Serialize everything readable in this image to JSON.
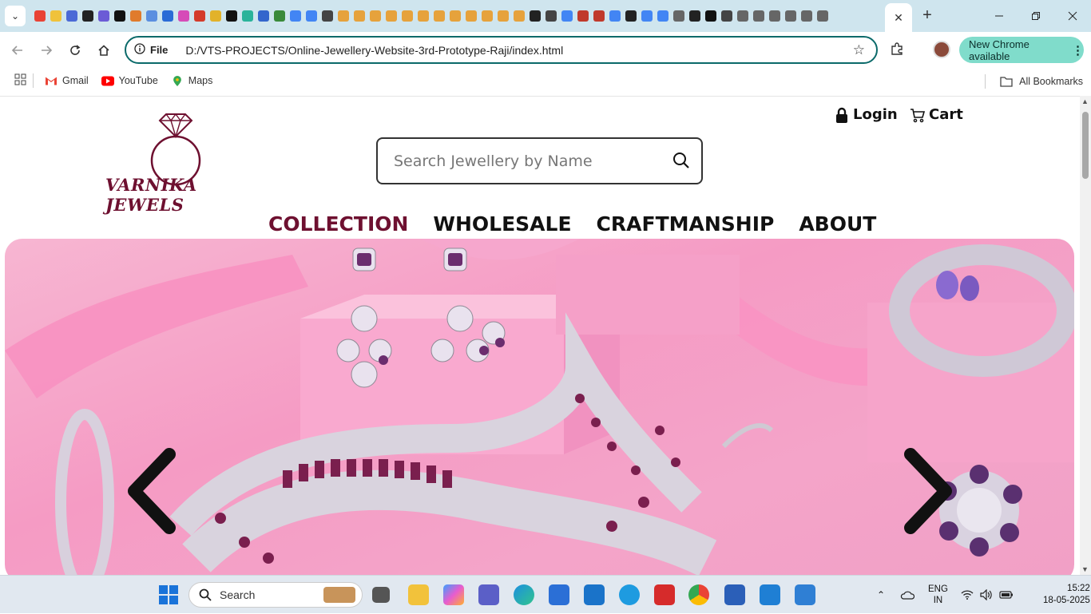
{
  "browser": {
    "active_tab_close": "✕",
    "new_tab": "+",
    "url_prefix": "File",
    "url": "D:/VTS-PROJECTS/Online-Jewellery-Website-3rd-Prototype-Raji/index.html",
    "update_notice": "New Chrome available",
    "tab_favicon_colors": [
      "#e94335",
      "#f0c23b",
      "#4b6ad6",
      "#222",
      "#6b5bd6",
      "#111",
      "#e07b2c",
      "#5b8fe0",
      "#2a6bd6",
      "#d64bb8",
      "#d43b2a",
      "#e2b22a",
      "#111",
      "#2ab39a",
      "#36c",
      "#3a8a3a",
      "#4285f4",
      "#4285f4",
      "#444",
      "#e6a23c",
      "#e6a23c",
      "#e6a23c",
      "#e6a23c",
      "#e6a23c",
      "#e6a23c",
      "#e6a23c",
      "#e6a23c",
      "#e6a23c",
      "#e6a23c",
      "#e6a23c",
      "#e6a23c",
      "#222",
      "#444",
      "#4285f4",
      "#c0392b",
      "#c0392b",
      "#4285f4",
      "#222",
      "#4285f4",
      "#4285f4",
      "#666",
      "#222",
      "#111",
      "#444",
      "#666",
      "#666",
      "#666",
      "#666",
      "#666",
      "#666"
    ]
  },
  "bookmarks": {
    "items": [
      {
        "label": "Gmail",
        "color": "#ea4335"
      },
      {
        "label": "YouTube",
        "color": "#ff0000"
      },
      {
        "label": "Maps",
        "color": "#34a853"
      }
    ],
    "all_label": "All Bookmarks"
  },
  "site": {
    "brand": "VARNIKA JEWELS",
    "brand_color": "#6e1030",
    "search_placeholder": "Search Jewellery by Name",
    "login_label": "Login",
    "cart_label": "Cart",
    "nav": [
      {
        "label": "COLLECTION",
        "active": true
      },
      {
        "label": "WHOLESALE",
        "active": false
      },
      {
        "label": "CRAFTMANSHIP",
        "active": false
      },
      {
        "label": "ABOUT",
        "active": false
      }
    ]
  },
  "taskbar": {
    "search_label": "Search",
    "lang_top": "ENG",
    "lang_bottom": "IN",
    "time": "15:22",
    "date": "18-05-2025"
  }
}
